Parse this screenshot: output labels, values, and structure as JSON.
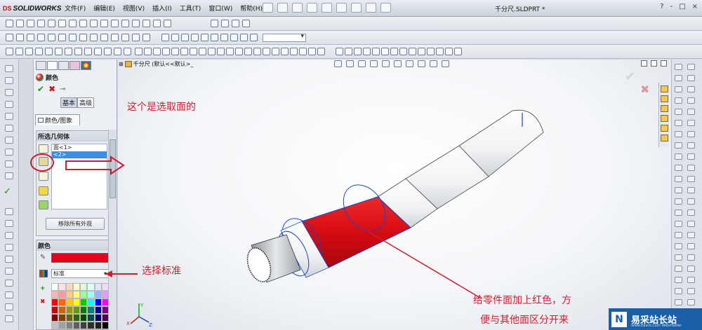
{
  "app": {
    "logo_text": "SOLIDWORKS",
    "logo_mark": "DS",
    "document_title": "千分尺.SLDPRT *",
    "menus": [
      "文件(F)",
      "编辑(E)",
      "视图(V)",
      "插入(I)",
      "工具(T)",
      "窗口(W)",
      "帮助(H)"
    ],
    "window_controls": [
      "?",
      "-",
      "□",
      "×"
    ]
  },
  "property_manager": {
    "title": "颜色",
    "ok_symbol": "✔",
    "cancel_symbol": "✖",
    "pin_symbol": "⊸",
    "mode_basic": "基本",
    "mode_advanced": "高级",
    "tab_label": "颜色/图象",
    "selection_group": {
      "title": "所选几何体",
      "items": [
        "面<1>",
        "<2>"
      ],
      "remove_button": "移除所有外观"
    },
    "color_group": {
      "title": "颜色",
      "current_color": "#e4001a",
      "palette_select": "标准",
      "palette": [
        "#ffffff",
        "#ffe0e0",
        "#ffd9b3",
        "#ffffcc",
        "#d9ffd9",
        "#d9ffff",
        "#d9e6ff",
        "#f0d9ff",
        "#ffb3b3",
        "#ff9999",
        "#ffcc80",
        "#ffff80",
        "#99ff99",
        "#99ffff",
        "#99b3ff",
        "#e699ff",
        "#ff0000",
        "#ff6600",
        "#ffcc00",
        "#ffff00",
        "#00cc00",
        "#00ffff",
        "#0000ff",
        "#ff00ff",
        "#cc0000",
        "#cc6600",
        "#999900",
        "#669900",
        "#008000",
        "#008080",
        "#000099",
        "#800080",
        "#800000",
        "#804000",
        "#666600",
        "#336600",
        "#004d00",
        "#004d4d",
        "#000066",
        "#4d004d",
        "#c0c0c0",
        "#a0a0a0",
        "#808080",
        "#606060",
        "#404040",
        "#303030",
        "#202020",
        "#000000"
      ]
    }
  },
  "graphics": {
    "tree_label": "千分尺  (默认<<默认>_",
    "ok_symbol": "✔",
    "cancel_symbol": "✖"
  },
  "callouts": {
    "select_face": "这个是选取面的",
    "select_standard": "选择标准",
    "note_line1": "给零件面加上红色，方",
    "note_line2": "便与其他面区分开来"
  },
  "watermark": {
    "logo": "N",
    "text": "易采站长站",
    "sub": "Www.Easck.Com  Webmaster"
  }
}
